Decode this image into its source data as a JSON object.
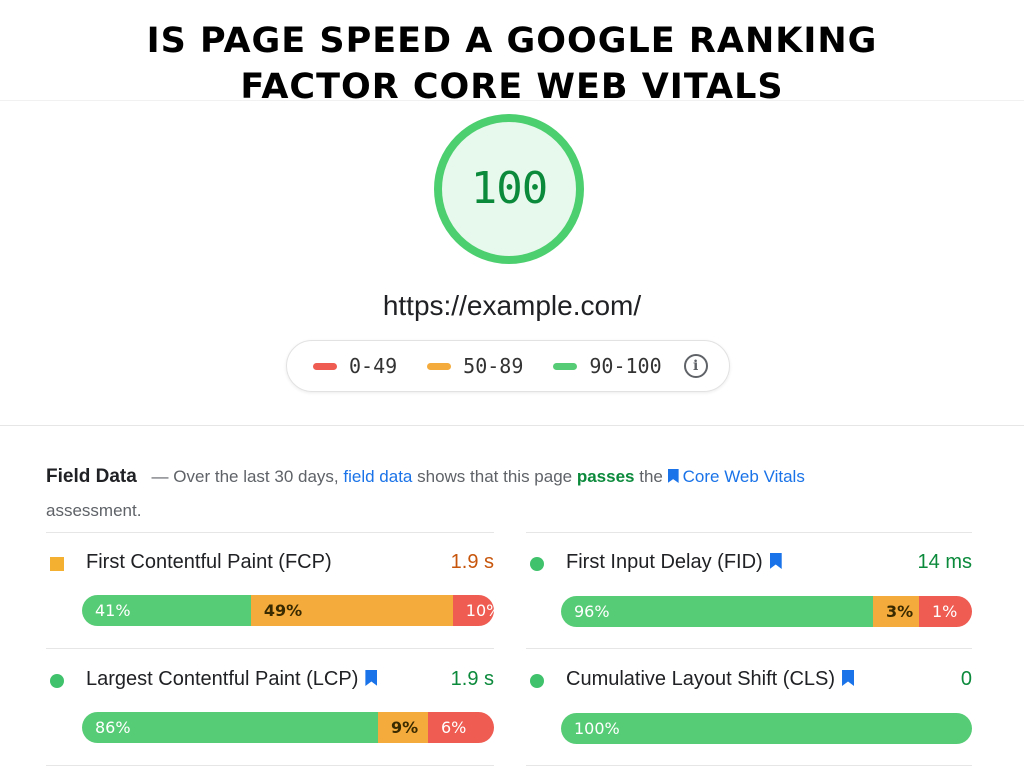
{
  "headline": {
    "line1": "IS PAGE SPEED A GOOGLE RANKING",
    "line2": "FACTOR CORE WEB VITALS"
  },
  "score": {
    "value": "100",
    "url": "https://example.com/"
  },
  "legend": {
    "items": [
      {
        "label": "0-49",
        "color": "#ee5c52"
      },
      {
        "label": "50-89",
        "color": "#f4ab3b"
      },
      {
        "label": "90-100",
        "color": "#57cc76"
      }
    ],
    "info_icon": "info-icon"
  },
  "field_data": {
    "title": "Field Data",
    "dash": "—",
    "text_1": "Over the last 30 days,",
    "field_data_link": "field data",
    "text_2": "shows that this page",
    "passes": "passes",
    "text_3": "the",
    "cwv_link": "Core Web Vitals",
    "text_4": "assessment."
  },
  "metrics": [
    {
      "label": "First Contentful Paint (FCP)",
      "value": "1.9 s",
      "bar": [
        "41%",
        "49%",
        "10%"
      ],
      "dist": [
        41,
        49,
        10
      ]
    },
    {
      "label": "First Input Delay (FID)",
      "value": "14 ms",
      "bar": [
        "96%",
        "3%",
        "1%"
      ],
      "dist": [
        96,
        3,
        1
      ]
    },
    {
      "label": "Largest Contentful Paint (LCP)",
      "value": "1.9 s",
      "bar": [
        "86%",
        "9%",
        "6%"
      ],
      "dist": [
        86,
        9,
        6
      ]
    },
    {
      "label": "Cumulative Layout Shift (CLS)",
      "value": "0",
      "bar": [
        "100%"
      ],
      "dist": [
        100,
        0,
        0
      ]
    }
  ],
  "colors": {
    "good": "#57cc76",
    "needs_improvement": "#f4ab3b",
    "poor": "#ee5c52",
    "link": "#1a73e8",
    "pass": "#0c8a3c"
  }
}
